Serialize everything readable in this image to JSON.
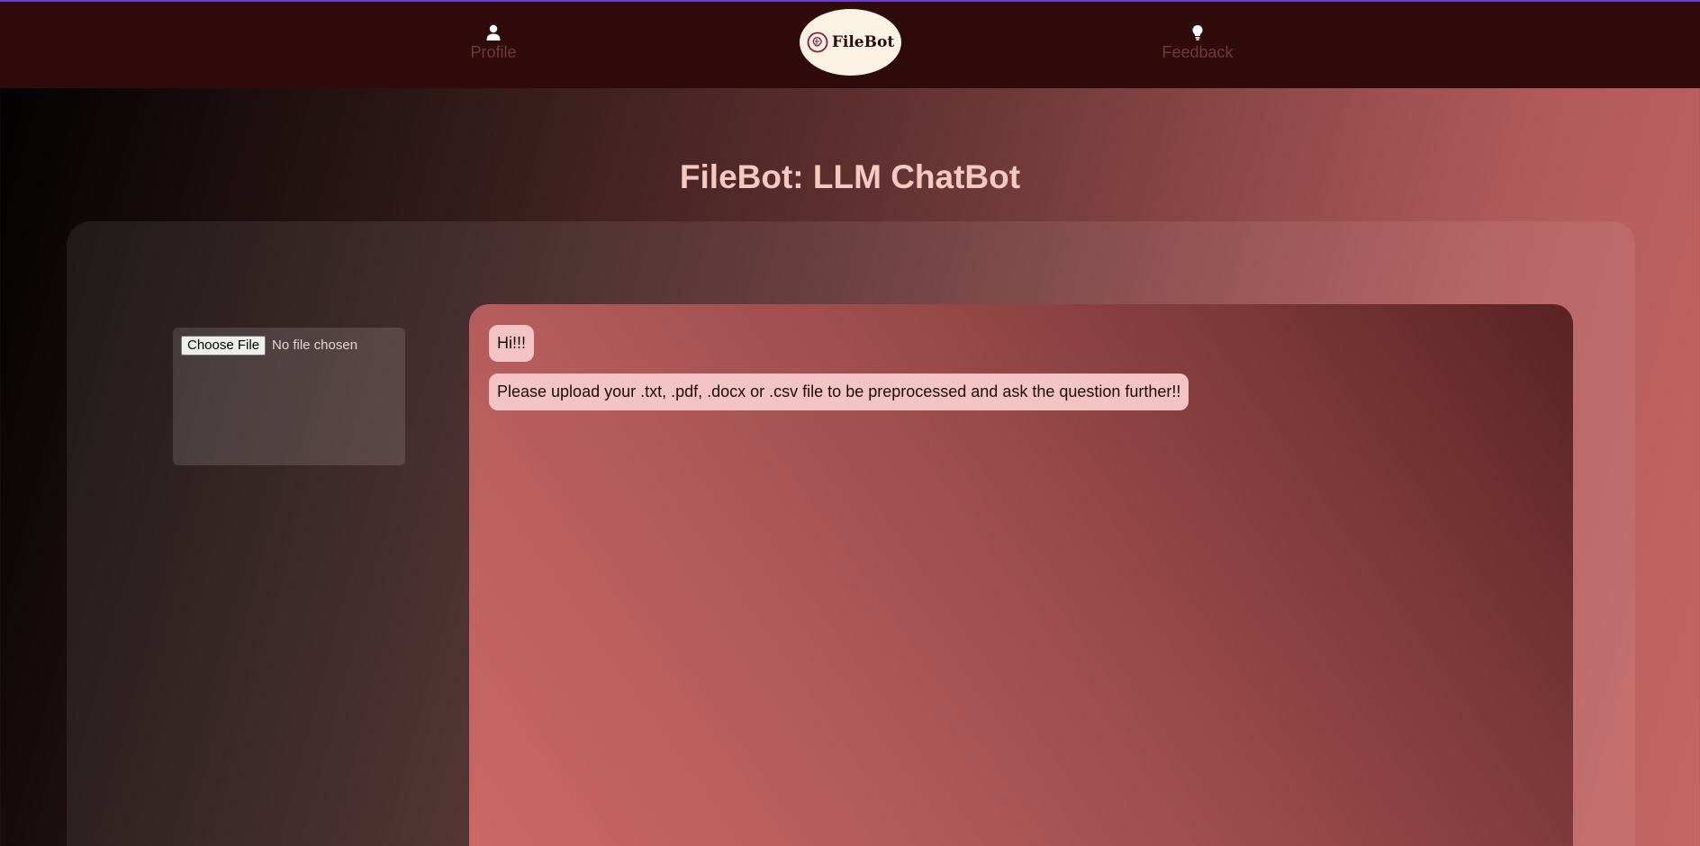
{
  "nav": {
    "profile_label": "Profile",
    "profile_icon": "user-icon",
    "feedback_label": "Feedback",
    "feedback_icon": "lightbulb-icon",
    "logo_text": "FileBot"
  },
  "page": {
    "title": "FileBot: LLM ChatBot"
  },
  "upload": {
    "button_label": "Choose File",
    "status_text": "No file chosen"
  },
  "chat": {
    "messages": [
      {
        "text": "Hi!!!"
      },
      {
        "text": "Please upload your .txt, .pdf, .docx or .csv file to be preprocessed and ask the question further!!"
      }
    ]
  },
  "colors": {
    "navbar_bg": "#2f0b0b",
    "top_accent": "#6a3fcf",
    "title": "#f5c8c0",
    "bubble": "#f4c4c4",
    "nav_text": "#6e3a3a"
  }
}
